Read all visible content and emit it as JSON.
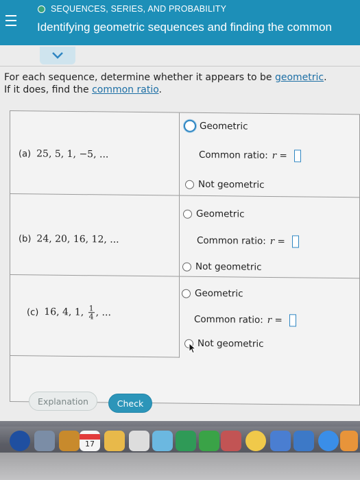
{
  "header": {
    "topic": "SEQUENCES, SERIES, AND PROBABILITY",
    "title": "Identifying geometric sequences and finding the common"
  },
  "instructions": {
    "line1_prefix": "For each sequence, determine whether it appears to be ",
    "line1_link": "geometric",
    "line1_suffix": ".",
    "line2_prefix": "If it does, find the ",
    "line2_link": "common ratio",
    "line2_suffix": "."
  },
  "problems": [
    {
      "label": "(a)",
      "sequence": "25, 5, 1, −5, ...",
      "option_geometric": "Geometric",
      "ratio_label": "Common ratio:",
      "ratio_var": "r =",
      "option_not": "Not geometric"
    },
    {
      "label": "(b)",
      "sequence": "24, 20, 16, 12, ...",
      "option_geometric": "Geometric",
      "ratio_label": "Common ratio:",
      "ratio_var": "r =",
      "option_not": "Not geometric"
    },
    {
      "label": "(c)",
      "sequence_prefix": "16, 4, 1,",
      "frac_num": "1",
      "frac_den": "4",
      "sequence_suffix": ", ...",
      "option_geometric": "Geometric",
      "ratio_label": "Common ratio:",
      "ratio_var": "r =",
      "option_not": "Not geometric"
    }
  ],
  "buttons": {
    "explanation": "Explanation",
    "check": "Check"
  },
  "dock": {
    "calendar_day": "17"
  },
  "colors": {
    "header": "#1d8fb8",
    "link": "#1d6fa5",
    "check_button": "#2c95b9",
    "focus_ring": "#2f86c2"
  }
}
